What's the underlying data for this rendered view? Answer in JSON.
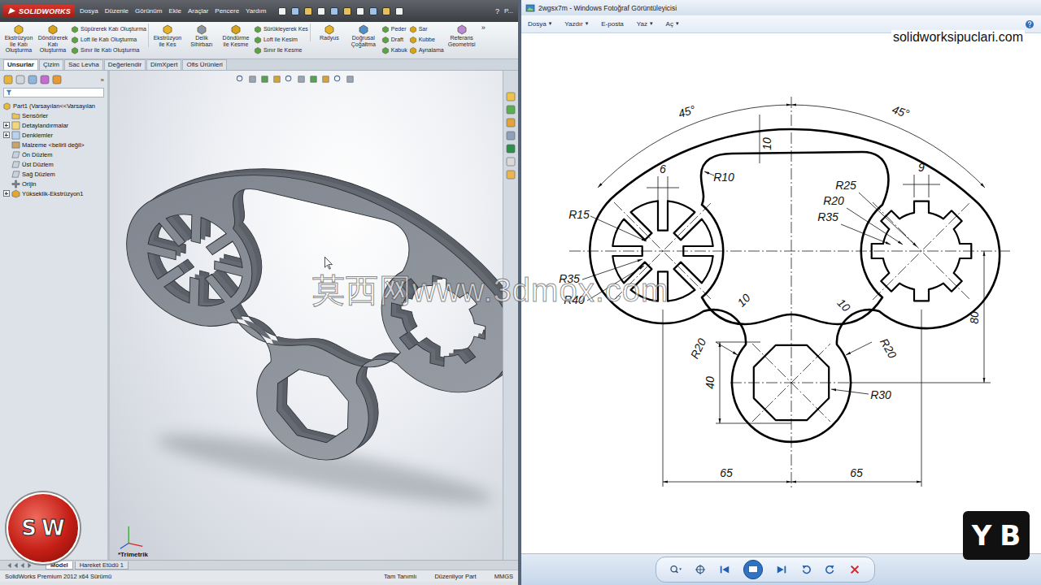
{
  "sw_window": {
    "logo": "SOLIDWORKS",
    "menus": [
      "Dosya",
      "Düzenle",
      "Görünüm",
      "Ekle",
      "Araçlar",
      "Pencere",
      "Yardım"
    ],
    "help": "?",
    "search": "P...",
    "ribbon": [
      {
        "kind": "big",
        "items": [
          {
            "label": "Ekstrüzyon İle Katı Oluşturma"
          }
        ]
      },
      {
        "kind": "big",
        "items": [
          {
            "label": "Döndürerek Katı Oluşturma"
          }
        ]
      },
      {
        "kind": "stack",
        "items": [
          {
            "label": "Süpürerek Katı Oluşturma"
          },
          {
            "label": "Loft ile Katı Oluşturma"
          },
          {
            "label": "Sınır ile Katı Oluşturma"
          }
        ]
      },
      {
        "kind": "big",
        "items": [
          {
            "label": "Ekstrüzyon ile Kes"
          }
        ]
      },
      {
        "kind": "big",
        "items": [
          {
            "label": "Delik Sihirbazı"
          }
        ]
      },
      {
        "kind": "big",
        "items": [
          {
            "label": "Döndürme ile Kesme"
          }
        ]
      },
      {
        "kind": "stack",
        "items": [
          {
            "label": "Sürükleyerek Kes"
          },
          {
            "label": "Loft ile Kesim"
          },
          {
            "label": "Sınır ile Kesme"
          }
        ]
      },
      {
        "kind": "big",
        "items": [
          {
            "label": "Radyus"
          }
        ]
      },
      {
        "kind": "big",
        "items": [
          {
            "label": "Doğrusal Çoğaltma"
          }
        ]
      },
      {
        "kind": "stack",
        "items": [
          {
            "label": "Peder"
          },
          {
            "label": "Draft"
          },
          {
            "label": "Kabuk"
          }
        ]
      },
      {
        "kind": "stack",
        "items": [
          {
            "label": "Sar"
          },
          {
            "label": "Kubbe"
          },
          {
            "label": "Aynalama"
          }
        ]
      },
      {
        "kind": "big",
        "items": [
          {
            "label": "Referans Geometrisi"
          }
        ]
      }
    ],
    "ribbon_more": "»",
    "tabs": [
      {
        "label": "Unsurlar",
        "selected": true
      },
      {
        "label": "Çizim",
        "selected": false
      },
      {
        "label": "Sac Levha",
        "selected": false
      },
      {
        "label": "Değerlendir",
        "selected": false
      },
      {
        "label": "DimXpert",
        "selected": false
      },
      {
        "label": "Ofis Ürünleri",
        "selected": false
      }
    ],
    "tree_more": "»",
    "tree": [
      {
        "label": "Part1 (Varsayılan<<Varsayılan",
        "kind": "part",
        "expandable": false
      },
      {
        "label": "Sensörler",
        "kind": "sensor",
        "expandable": false
      },
      {
        "label": "Detaylandırmalar",
        "kind": "annotation",
        "expandable": true
      },
      {
        "label": "Denklemler",
        "kind": "equation",
        "expandable": true
      },
      {
        "label": "Malzeme <belirli değil>",
        "kind": "material",
        "expandable": false
      },
      {
        "label": "Ön Düzlem",
        "kind": "plane",
        "expandable": false
      },
      {
        "label": "Üst Düzlem",
        "kind": "plane",
        "expandable": false
      },
      {
        "label": "Sağ Düzlem",
        "kind": "plane",
        "expandable": false
      },
      {
        "label": "Orijin",
        "kind": "origin",
        "expandable": false
      },
      {
        "label": "Yükseklik-Ekstrüzyon1",
        "kind": "feature",
        "expandable": true
      }
    ],
    "view_label": "*Trimetrik",
    "bottom_tabs": [
      {
        "label": "Model",
        "selected": true
      },
      {
        "label": "Hareket Etüdü 1",
        "selected": false
      }
    ],
    "status": [
      "SolidWorks Premium 2012 x64 Sürümü",
      "Tam Tanımlı",
      "Düzenliyor Part",
      "MMGS"
    ]
  },
  "viewer": {
    "title": "2wgsx7m - Windows Fotoğraf Görüntüleyicisi",
    "menu": {
      "caret": "▾",
      "items": [
        {
          "label": "Dosya",
          "dropdown": true
        },
        {
          "label": "Yazdır",
          "dropdown": true
        },
        {
          "label": "E-posta",
          "dropdown": false
        },
        {
          "label": "Yaz",
          "dropdown": true
        },
        {
          "label": "Aç",
          "dropdown": true
        }
      ]
    },
    "drawing": {
      "dimensions": [
        "45°",
        "45°",
        "10",
        "R10",
        "6",
        "9",
        "R25",
        "R20",
        "R35",
        "R15",
        "R35",
        "R40",
        "10",
        "10",
        "R20",
        "R20",
        "40",
        "R30",
        "65",
        "65",
        "80"
      ]
    }
  },
  "watermarks": {
    "center": "莫西网www.3dmox.com",
    "site": "solidworksipuclari.com"
  },
  "logos": {
    "sw": "SW",
    "yb": "YB"
  }
}
